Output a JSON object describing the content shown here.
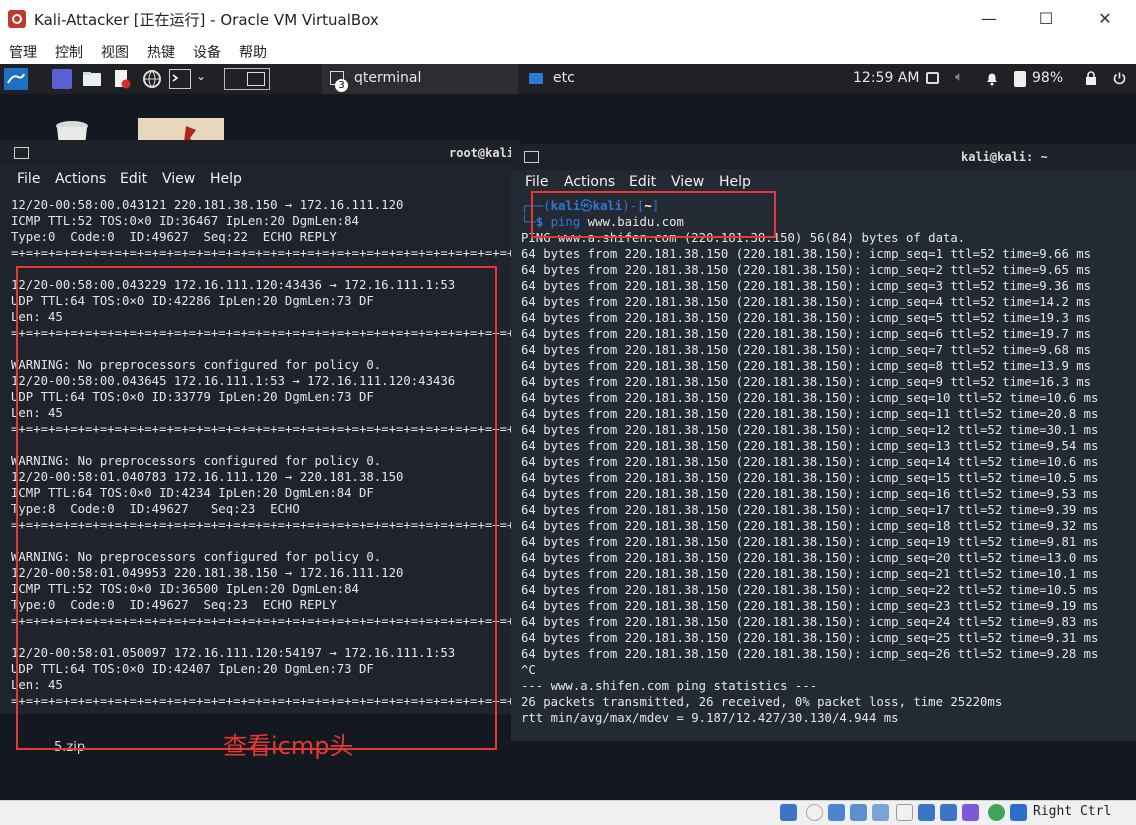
{
  "window": {
    "title": "Kali-Attacker [正在运行] - Oracle VM VirtualBox",
    "minimize": "—",
    "maximize": "☐",
    "close": "✕"
  },
  "vbox_menu": [
    "管理",
    "控制",
    "视图",
    "热键",
    "设备",
    "帮助"
  ],
  "panel": {
    "task_terminal": "qterminal",
    "task_terminal_badge": "3",
    "task_folder": "etc",
    "clock": "12:59 AM",
    "battery": "98%"
  },
  "desktop": {
    "zip_label": "5.zip",
    "annotation": "查看icmp头"
  },
  "left_terminal": {
    "title": "root@kali:",
    "menu": [
      "File",
      "Actions",
      "Edit",
      "View",
      "Help"
    ],
    "lines": [
      "12/20-00:58:00.043121 220.181.38.150 → 172.16.111.120",
      "ICMP TTL:52 TOS:0×0 ID:36467 IpLen:20 DgmLen:84",
      "Type:0  Code:0  ID:49627  Seq:22  ECHO REPLY",
      "=+=+=+=+=+=+=+=+=+=+=+=+=+=+=+=+=+=+=+=+=+=+=+=+=+=+=+=+=+=+=+=+=+=+=+=+=+=+=+",
      "",
      "12/20-00:58:00.043229 172.16.111.120:43436 → 172.16.111.1:53",
      "UDP TTL:64 TOS:0×0 ID:42286 IpLen:20 DgmLen:73 DF",
      "Len: 45",
      "=+=+=+=+=+=+=+=+=+=+=+=+=+=+=+=+=+=+=+=+=+=+=+=+=+=+=+=+=+=+=+=+=+=+=+=+=+=+=+",
      "",
      "WARNING: No preprocessors configured for policy 0.",
      "12/20-00:58:00.043645 172.16.111.1:53 → 172.16.111.120:43436",
      "UDP TTL:64 TOS:0×0 ID:33779 IpLen:20 DgmLen:73 DF",
      "Len: 45",
      "=+=+=+=+=+=+=+=+=+=+=+=+=+=+=+=+=+=+=+=+=+=+=+=+=+=+=+=+=+=+=+=+=+=+=+=+=+=+=+",
      "",
      "WARNING: No preprocessors configured for policy 0.",
      "12/20-00:58:01.040783 172.16.111.120 → 220.181.38.150",
      "ICMP TTL:64 TOS:0×0 ID:4234 IpLen:20 DgmLen:84 DF",
      "Type:8  Code:0  ID:49627   Seq:23  ECHO",
      "=+=+=+=+=+=+=+=+=+=+=+=+=+=+=+=+=+=+=+=+=+=+=+=+=+=+=+=+=+=+=+=+=+=+=+=+=+=+=+",
      "",
      "WARNING: No preprocessors configured for policy 0.",
      "12/20-00:58:01.049953 220.181.38.150 → 172.16.111.120",
      "ICMP TTL:52 TOS:0×0 ID:36500 IpLen:20 DgmLen:84",
      "Type:0  Code:0  ID:49627  Seq:23  ECHO REPLY",
      "=+=+=+=+=+=+=+=+=+=+=+=+=+=+=+=+=+=+=+=+=+=+=+=+=+=+=+=+=+=+=+=+=+=+=+=+=+=+=+",
      "",
      "12/20-00:58:01.050097 172.16.111.120:54197 → 172.16.111.1:53",
      "UDP TTL:64 TOS:0×0 ID:42407 IpLen:20 DgmLen:73 DF",
      "Len: 45",
      "=+=+=+=+=+=+=+=+=+=+=+=+=+=+=+=+=+=+=+=+=+=+=+=+=+=+=+=+=+=+=+=+=+=+=+=+=+=+=+"
    ]
  },
  "right_terminal": {
    "title": "kali@kali: ~",
    "menu": [
      "File",
      "Actions",
      "Edit",
      "View",
      "Help"
    ],
    "prompt_user": "kali",
    "prompt_at": "㉿",
    "prompt_host": "kali",
    "prompt_dir": "~",
    "command_name": "ping",
    "command_arg": "www.baidu.com",
    "header": "PING www.a.shifen.com (220.181.38.150) 56(84) bytes of data.",
    "replies": [
      "64 bytes from 220.181.38.150 (220.181.38.150): icmp_seq=1 ttl=52 time=9.66 ms",
      "64 bytes from 220.181.38.150 (220.181.38.150): icmp_seq=2 ttl=52 time=9.65 ms",
      "64 bytes from 220.181.38.150 (220.181.38.150): icmp_seq=3 ttl=52 time=9.36 ms",
      "64 bytes from 220.181.38.150 (220.181.38.150): icmp_seq=4 ttl=52 time=14.2 ms",
      "64 bytes from 220.181.38.150 (220.181.38.150): icmp_seq=5 ttl=52 time=19.3 ms",
      "64 bytes from 220.181.38.150 (220.181.38.150): icmp_seq=6 ttl=52 time=19.7 ms",
      "64 bytes from 220.181.38.150 (220.181.38.150): icmp_seq=7 ttl=52 time=9.68 ms",
      "64 bytes from 220.181.38.150 (220.181.38.150): icmp_seq=8 ttl=52 time=13.9 ms",
      "64 bytes from 220.181.38.150 (220.181.38.150): icmp_seq=9 ttl=52 time=16.3 ms",
      "64 bytes from 220.181.38.150 (220.181.38.150): icmp_seq=10 ttl=52 time=10.6 ms",
      "64 bytes from 220.181.38.150 (220.181.38.150): icmp_seq=11 ttl=52 time=20.8 ms",
      "64 bytes from 220.181.38.150 (220.181.38.150): icmp_seq=12 ttl=52 time=30.1 ms",
      "64 bytes from 220.181.38.150 (220.181.38.150): icmp_seq=13 ttl=52 time=9.54 ms",
      "64 bytes from 220.181.38.150 (220.181.38.150): icmp_seq=14 ttl=52 time=10.6 ms",
      "64 bytes from 220.181.38.150 (220.181.38.150): icmp_seq=15 ttl=52 time=10.5 ms",
      "64 bytes from 220.181.38.150 (220.181.38.150): icmp_seq=16 ttl=52 time=9.53 ms",
      "64 bytes from 220.181.38.150 (220.181.38.150): icmp_seq=17 ttl=52 time=9.39 ms",
      "64 bytes from 220.181.38.150 (220.181.38.150): icmp_seq=18 ttl=52 time=9.32 ms",
      "64 bytes from 220.181.38.150 (220.181.38.150): icmp_seq=19 ttl=52 time=9.81 ms",
      "64 bytes from 220.181.38.150 (220.181.38.150): icmp_seq=20 ttl=52 time=13.0 ms",
      "64 bytes from 220.181.38.150 (220.181.38.150): icmp_seq=21 ttl=52 time=10.1 ms",
      "64 bytes from 220.181.38.150 (220.181.38.150): icmp_seq=22 ttl=52 time=10.5 ms",
      "64 bytes from 220.181.38.150 (220.181.38.150): icmp_seq=23 ttl=52 time=9.19 ms",
      "64 bytes from 220.181.38.150 (220.181.38.150): icmp_seq=24 ttl=52 time=9.83 ms",
      "64 bytes from 220.181.38.150 (220.181.38.150): icmp_seq=25 ttl=52 time=9.31 ms",
      "64 bytes from 220.181.38.150 (220.181.38.150): icmp_seq=26 ttl=52 time=9.28 ms"
    ],
    "interrupt": "^C",
    "stats_header": "--- www.a.shifen.com ping statistics ---",
    "stats_packets": "26 packets transmitted, 26 received, 0% packet loss, time 25220ms",
    "stats_rtt": "rtt min/avg/max/mdev = 9.187/12.427/30.130/4.944 ms"
  },
  "status_bar": {
    "host_key": "Right Ctrl"
  },
  "colors": {
    "terminal_bg": "#232a33",
    "prompt_blue": "#2e7bd6",
    "annotation_red": "#e53935"
  }
}
